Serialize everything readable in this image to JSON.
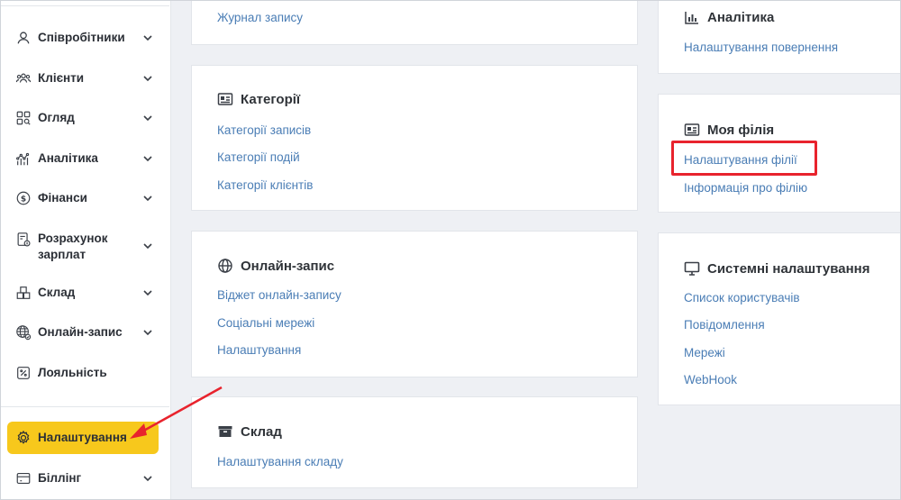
{
  "sidebar": {
    "items": [
      {
        "label": "Співробітники",
        "icon": "user-icon",
        "chevron": true
      },
      {
        "label": "Клієнти",
        "icon": "clients-icon",
        "chevron": true
      },
      {
        "label": "Огляд",
        "icon": "overview-icon",
        "chevron": true
      },
      {
        "label": "Аналітика",
        "icon": "analytics-icon",
        "chevron": true
      },
      {
        "label": "Фінанси",
        "icon": "finance-icon",
        "chevron": true
      },
      {
        "label": "Розрахунок зарплат",
        "icon": "payroll-icon",
        "chevron": true
      },
      {
        "label": "Склад",
        "icon": "warehouse-icon",
        "chevron": true
      },
      {
        "label": "Онлайн-запис",
        "icon": "online-booking-icon",
        "chevron": true
      },
      {
        "label": "Лояльність",
        "icon": "loyalty-icon",
        "chevron": false
      }
    ],
    "settings_label": "Налаштування",
    "billing_label": "Біллінг",
    "active_color": "#f7c81c"
  },
  "cards": {
    "journal": {
      "links": [
        "Журнал запису"
      ]
    },
    "categories": {
      "title": "Категорії",
      "links": [
        "Категорії записів",
        "Категорії подій",
        "Категорії клієнтів"
      ]
    },
    "online": {
      "title": "Онлайн-запис",
      "links": [
        "Віджет онлайн-запису",
        "Соціальні мережі",
        "Налаштування"
      ]
    },
    "warehouse": {
      "title": "Склад",
      "links": [
        "Налаштування складу"
      ]
    },
    "analytics": {
      "title": "Аналітика",
      "links": [
        "Налаштування повернення"
      ]
    },
    "branch": {
      "title": "Моя філія",
      "links": [
        "Налаштування філії",
        "Інформація про філію"
      ]
    },
    "system": {
      "title": "Системні налаштування",
      "links": [
        "Список користувачів",
        "Повідомлення",
        "Мережі",
        "WebHook"
      ]
    }
  },
  "colors": {
    "link": "#4a7db5",
    "highlight": "#e8232d"
  }
}
